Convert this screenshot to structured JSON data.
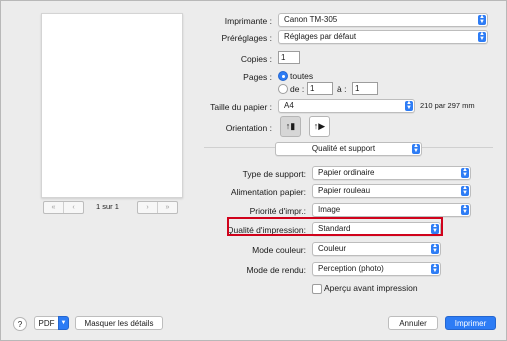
{
  "preview": {
    "page_indicator": "1 sur 1",
    "first_icon": "«",
    "prev_icon": "‹",
    "next_icon": "›",
    "last_icon": "»"
  },
  "printer": {
    "label": "Imprimante :",
    "value": "Canon TM-305"
  },
  "presets": {
    "label": "Préréglages :",
    "value": "Réglages par défaut"
  },
  "copies": {
    "label": "Copies :",
    "value": "1"
  },
  "pages": {
    "label": "Pages :",
    "all_label": "toutes",
    "from_label": "de :",
    "from_value": "1",
    "to_label": "à :",
    "to_value": "1",
    "selected": "toutes"
  },
  "paper_size": {
    "label": "Taille du papier :",
    "value": "A4",
    "dimensions": "210 par 297 mm"
  },
  "orientation": {
    "label": "Orientation :",
    "portrait_icon": "portrait-icon",
    "landscape_icon": "landscape-icon",
    "selected": "portrait"
  },
  "section": {
    "value": "Qualité et support"
  },
  "media_type": {
    "label": "Type de support:",
    "value": "Papier ordinaire"
  },
  "paper_source": {
    "label": "Alimentation papier:",
    "value": "Papier rouleau"
  },
  "print_priority": {
    "label": "Priorité d'impr.:",
    "value": "Image"
  },
  "print_quality": {
    "label": "Qualité d'impression:",
    "value": "Standard"
  },
  "color_mode": {
    "label": "Mode couleur:",
    "value": "Couleur"
  },
  "render_mode": {
    "label": "Mode de rendu:",
    "value": "Perception (photo)"
  },
  "preview_option": {
    "label": "Aperçu avant impression",
    "checked": false
  },
  "footer": {
    "help": "?",
    "pdf": "PDF",
    "hide_details": "Masquer les détails",
    "cancel": "Annuler",
    "print": "Imprimer"
  },
  "colors": {
    "accent": "#2d7cf5",
    "highlight": "#d0021b"
  }
}
